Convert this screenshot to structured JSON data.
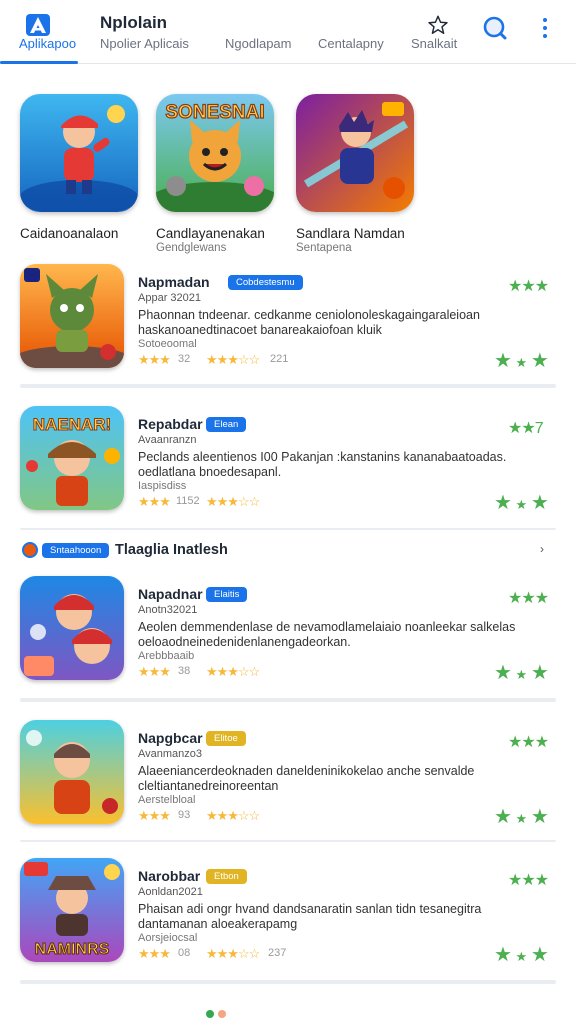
{
  "header": {
    "app_title": "Nplolain",
    "tabs": [
      {
        "label": "Aplikapoo"
      },
      {
        "label": "Npolier Aplicais"
      },
      {
        "label": "Ngodlapam"
      },
      {
        "label": "Centalapny"
      },
      {
        "label": "Snalkait"
      }
    ]
  },
  "featured": [
    {
      "title": "Caidanoanalaon",
      "subtitle": ""
    },
    {
      "title": "Candlayanenakan",
      "subtitle": "Gendglewans"
    },
    {
      "title": "Sandlara Namdan",
      "subtitle": "Sentapena"
    }
  ],
  "featured_art": {
    "banner_text": "SONESNAI"
  },
  "list": [
    {
      "name": "Napmadan",
      "badge": "Cobdestesmu",
      "badge_color": "#1a73e8",
      "developer": "Appar 32021",
      "description": "Phaonnan tndeenar. cedkanme ceniolonoleskagaingaraleioan haskanoanedtinacoet banareakaiofoan kluik",
      "meta": "Sotoeoomal",
      "stars_a": "★★★",
      "num_a": "32",
      "stars_b": "★★★☆☆",
      "num_b": "221",
      "icon_label": "",
      "green_top": "★★★"
    },
    {
      "name": "Repabdar",
      "badge": "Elean",
      "badge_color": "#1a73e8",
      "developer": "Avaanranzn",
      "description": "Peclands aleentienos I00 Pakanjan :kanstanins kananabaatoadas. oedlatlana bnoedesapanl.",
      "meta": "Iaspisdiss",
      "stars_a": "★★★",
      "num_a": "1152",
      "stars_b": "★★★☆☆",
      "num_b": "",
      "icon_label": "NAENAR!",
      "green_top": "★★7"
    },
    {
      "name": "Napadnar",
      "badge": "Elaitis",
      "badge_color": "#1a73e8",
      "developer": "Anotn32021",
      "description": "Aeolen demmendenlase de nevamodlamelaiaio noanleekar salkelas oeloaodneinedenidenlanengadeorkan.",
      "meta": "Arebbbaaib",
      "stars_a": "★★★",
      "num_a": "38",
      "stars_b": "★★★☆☆",
      "num_b": "",
      "icon_label": "",
      "green_top": "★★★"
    },
    {
      "name": "Napgbcar",
      "badge": "Elitoe",
      "badge_color": "#e0b422",
      "developer": "Avanmanzo3",
      "description": "Alaeeniancerdeoknaden daneldeninikokelao anche senvalde cleltiantanedreinoreentan",
      "meta": "Aerstelbloal",
      "stars_a": "★★★",
      "num_a": "93",
      "stars_b": "★★★☆☆",
      "num_b": "",
      "icon_label": "",
      "green_top": "★★★"
    },
    {
      "name": "Narobbar",
      "badge": "Etbon",
      "badge_color": "#e0b422",
      "developer": "Aonldan2021",
      "description": "Phaisan adi ongr hvand dandsanaratin sanlan tidn tesanegitra dantamanan aloeakerapamg",
      "meta": "Aorsjeiocsal",
      "stars_a": "★★★",
      "num_a": "08",
      "stars_b": "★★★☆☆",
      "num_b": "237",
      "icon_label": "NAMINRS",
      "green_top": "★★★"
    }
  ],
  "section": {
    "chip": "Sntaahooon",
    "title": "Tlaaglia Inatlesh",
    "chevron": "›"
  },
  "colors": {
    "accent": "#1a73e8",
    "green": "#4caf50",
    "gold": "#f6b93b"
  }
}
